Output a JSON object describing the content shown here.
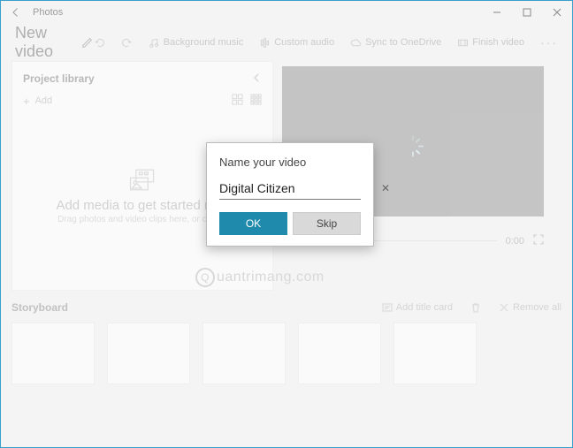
{
  "window": {
    "title": "Photos"
  },
  "header": {
    "video_title": "New video",
    "toolbar": {
      "undo": "",
      "redo": "",
      "bg_music": "Background music",
      "custom_audio": "Custom audio",
      "sync": "Sync to OneDrive",
      "finish": "Finish video"
    }
  },
  "library": {
    "title": "Project library",
    "add_label": "Add",
    "placeholder_title": "Add media to get started now",
    "placeholder_sub": "Drag photos and video clips here, or click A"
  },
  "preview": {
    "time": "0:00"
  },
  "storyboard": {
    "title": "Storyboard",
    "add_title_card": "Add title card",
    "remove_all": "Remove all"
  },
  "modal": {
    "title": "Name your video",
    "value": "Digital Citizen",
    "ok": "OK",
    "skip": "Skip"
  },
  "watermark": "uantrimang.com"
}
